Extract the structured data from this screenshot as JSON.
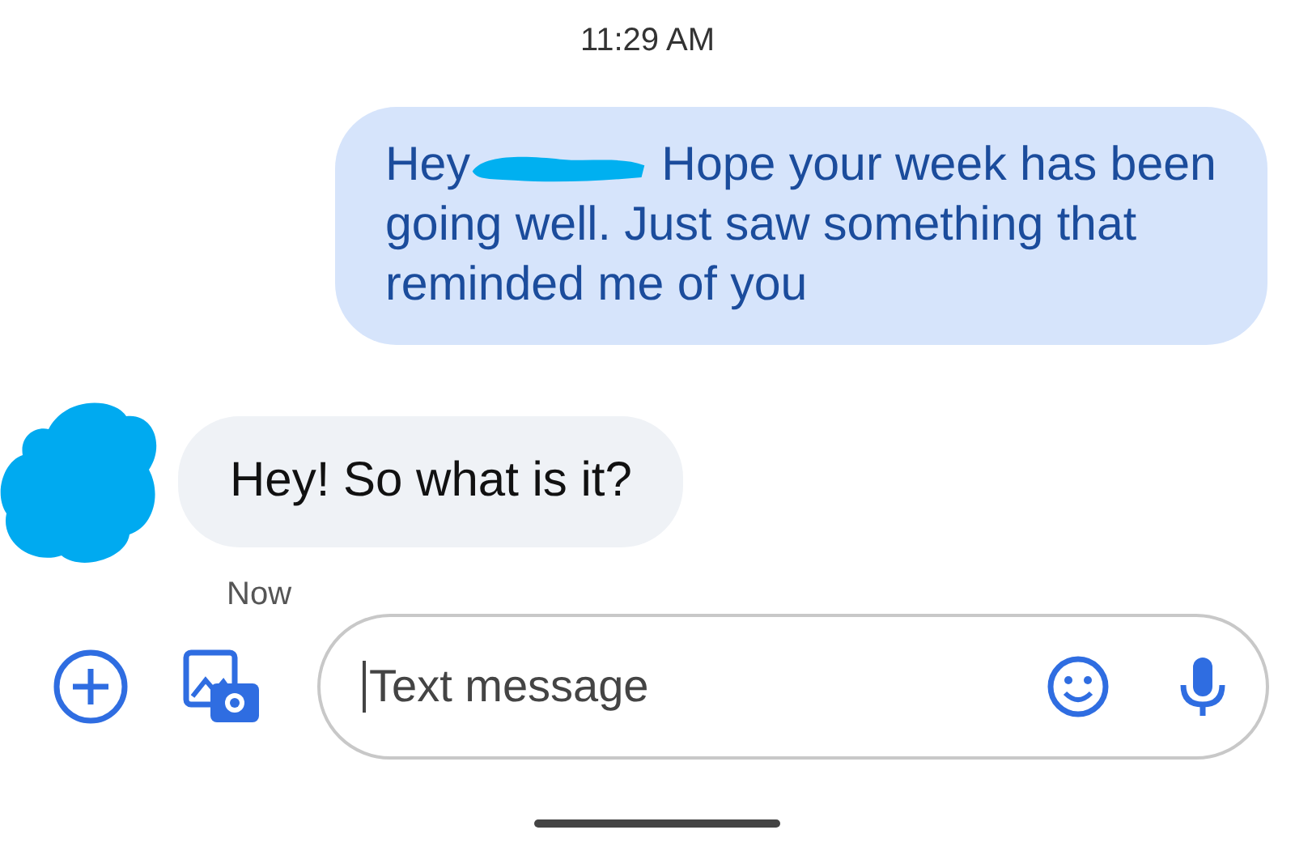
{
  "timestamp": "11:29 AM",
  "messages": [
    {
      "kind": "sent",
      "before": "Hey",
      "redacted": true,
      "text": "Hope your week has been going well. Just saw something that reminded me of you"
    },
    {
      "kind": "received",
      "redacted": true,
      "text": "Hey! So what is it?",
      "status": "Now"
    }
  ],
  "composer": {
    "placeholder": "Text message"
  }
}
